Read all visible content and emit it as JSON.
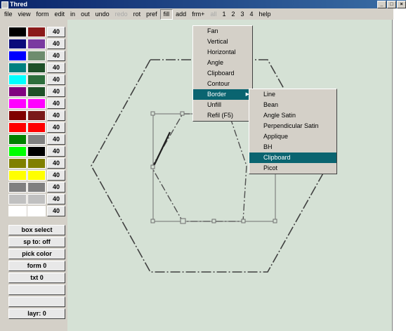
{
  "window": {
    "title": "Thred",
    "controls": [
      "_",
      "□",
      "×"
    ]
  },
  "menubar": [
    {
      "label": "file"
    },
    {
      "label": "view"
    },
    {
      "label": "form"
    },
    {
      "label": "edit"
    },
    {
      "label": "in"
    },
    {
      "label": "out"
    },
    {
      "label": "undo"
    },
    {
      "label": "redo",
      "disabled": true
    },
    {
      "label": "rot"
    },
    {
      "label": "pref"
    },
    {
      "label": "fill",
      "open": true
    },
    {
      "label": "add"
    },
    {
      "label": "frm+"
    },
    {
      "label": "all",
      "disabled": true
    },
    {
      "label": "1"
    },
    {
      "label": "2"
    },
    {
      "label": "3"
    },
    {
      "label": "4"
    },
    {
      "label": "help"
    }
  ],
  "palette": {
    "rows": [
      {
        "a": "#000000",
        "b": "#8b1a1a",
        "w": "40"
      },
      {
        "a": "#0a0a7a",
        "b": "#7a3aa0",
        "w": "40"
      },
      {
        "a": "#0000ff",
        "b": "#6e8c6e",
        "w": "40"
      },
      {
        "a": "#008080",
        "b": "#1e5028",
        "w": "40"
      },
      {
        "a": "#00ffff",
        "b": "#2d6e3c",
        "w": "40"
      },
      {
        "a": "#800080",
        "b": "#1e5028",
        "w": "40"
      },
      {
        "a": "#ff00ff",
        "b": "#ff00ff",
        "w": "40"
      },
      {
        "a": "#800000",
        "b": "#7a1a1a",
        "w": "40"
      },
      {
        "a": "#ff0000",
        "b": "#ff0000",
        "w": "40"
      },
      {
        "a": "#008000",
        "b": "#808080",
        "w": "40"
      },
      {
        "a": "#00ff00",
        "b": "#000000",
        "w": "40"
      },
      {
        "a": "#808000",
        "b": "#808000",
        "w": "40"
      },
      {
        "a": "#ffff00",
        "b": "#ffff00",
        "w": "40"
      },
      {
        "a": "#808080",
        "b": "#808080",
        "w": "40"
      },
      {
        "a": "#c0c0c0",
        "b": "#c0c0c0",
        "w": "40"
      },
      {
        "a": "#ffffff",
        "b": "#ffffff",
        "w": "40"
      }
    ],
    "buttons": [
      "box select",
      "sp to: off",
      "pick color",
      "form 0",
      "txt 0",
      "",
      "",
      "layr: 0"
    ]
  },
  "fill_menu": {
    "items": [
      "Fan",
      "Vertical",
      "Horizontal",
      "Angle",
      "Clipboard",
      "Contour",
      "Border",
      "Unfill",
      "Refil (F5)"
    ],
    "selected": "Border"
  },
  "border_submenu": {
    "items": [
      "Line",
      "Bean",
      "Angle Satin",
      "Perpendicular Satin",
      "Applique",
      "BH",
      "Clipboard",
      "Picot"
    ],
    "selected": "Clipboard"
  },
  "colors": {
    "menu_highlight": "#0a6470",
    "canvas_bg": "#d5e1d5"
  }
}
